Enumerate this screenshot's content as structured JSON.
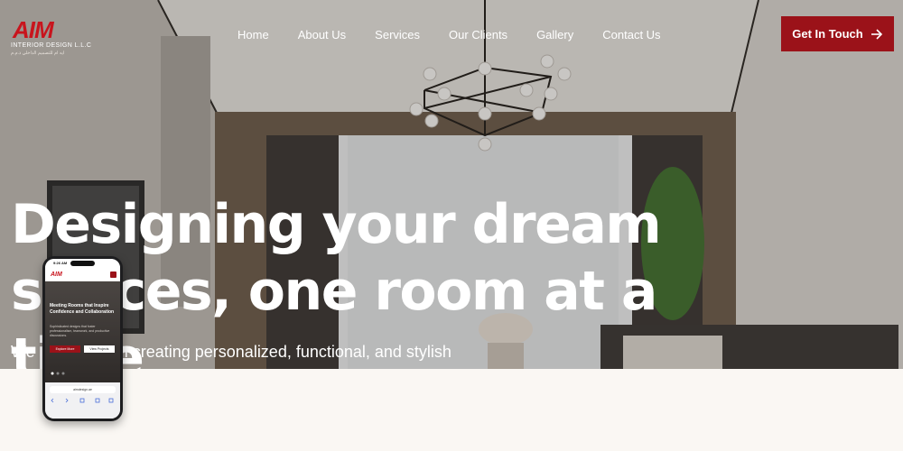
{
  "header": {
    "logo_text": "AIM",
    "logo_subtitle": "INTERIOR DESIGN L.L.C",
    "logo_arabic": "ايه ام للتصميم الداخلي ذ.م.م",
    "nav": [
      {
        "label": "Home"
      },
      {
        "label": "About Us"
      },
      {
        "label": "Services"
      },
      {
        "label": "Our Clients"
      },
      {
        "label": "Gallery"
      },
      {
        "label": "Contact Us"
      }
    ],
    "cta_label": "Get In Touch",
    "cta_icon": "arrow-right-icon"
  },
  "hero": {
    "headline": "Designing your dream spaces, one room at a time",
    "subtext": "We specialize in creating personalized, functional, and stylish"
  },
  "phone": {
    "time": "9:26 AM",
    "logo": "AIM",
    "title": "Meeting Rooms that Inspire Confidence and Collaboration",
    "description": "Sophisticated designs that foster professionalism, teamwork, and productive discussions.",
    "button_primary": "Explore More",
    "button_secondary": "View Projects",
    "url": "aimdesign.ae"
  },
  "colors": {
    "brand_red": "#9b1219",
    "logo_red": "#c8141d",
    "background": "#faf7f3",
    "text_white": "#ffffff"
  }
}
